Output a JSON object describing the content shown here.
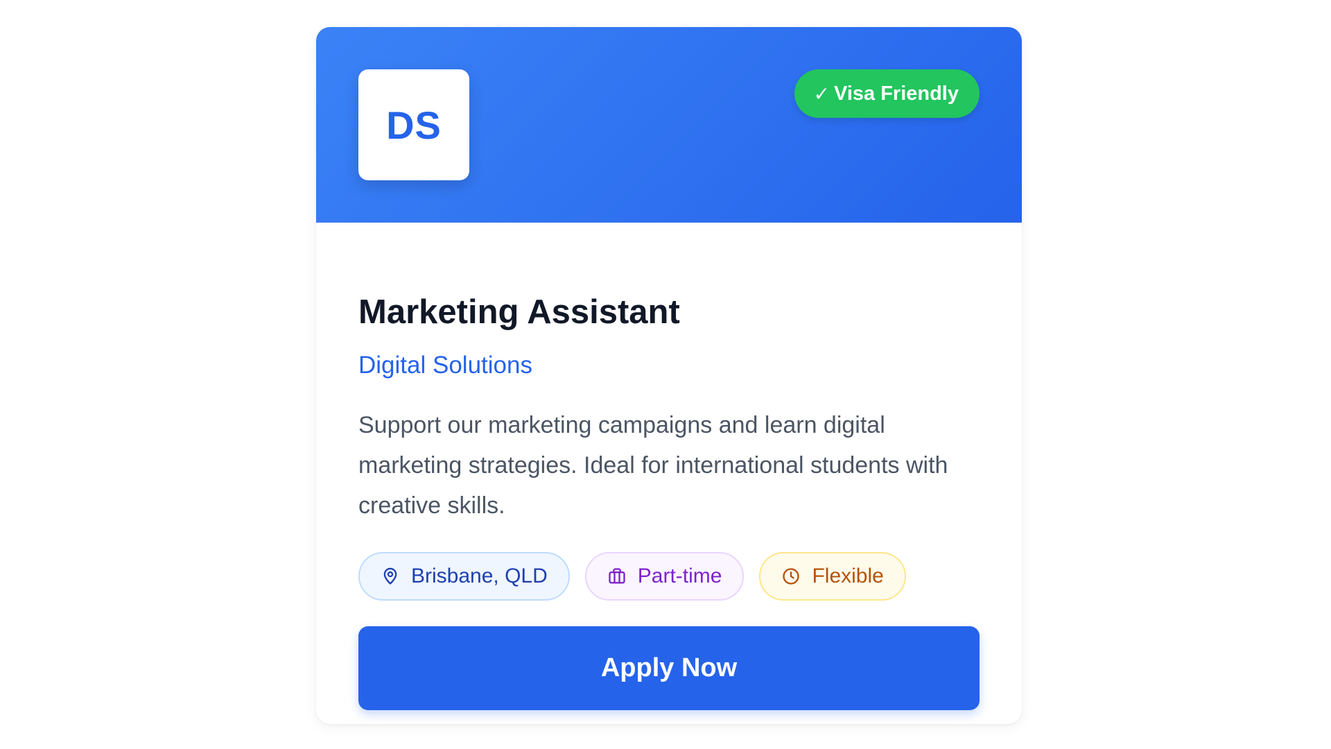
{
  "card": {
    "logo_initials": "DS",
    "badge": {
      "check": "✓",
      "label": "Visa Friendly",
      "color": "#22c55e"
    },
    "title": "Marketing Assistant",
    "company": "Digital Solutions",
    "description": "Support our marketing campaigns and learn digital marketing strategies. Ideal for international students with creative skills.",
    "tags": [
      {
        "label": "Brisbane, QLD",
        "icon": "map-pin-icon"
      },
      {
        "label": "Part-time",
        "icon": "briefcase-icon"
      },
      {
        "label": "Flexible",
        "icon": "clock-icon"
      }
    ],
    "apply_label": "Apply Now"
  },
  "colors": {
    "accent": "#2563eb",
    "header_gradient_start": "#3b82f6",
    "header_gradient_end": "#2563eb"
  }
}
